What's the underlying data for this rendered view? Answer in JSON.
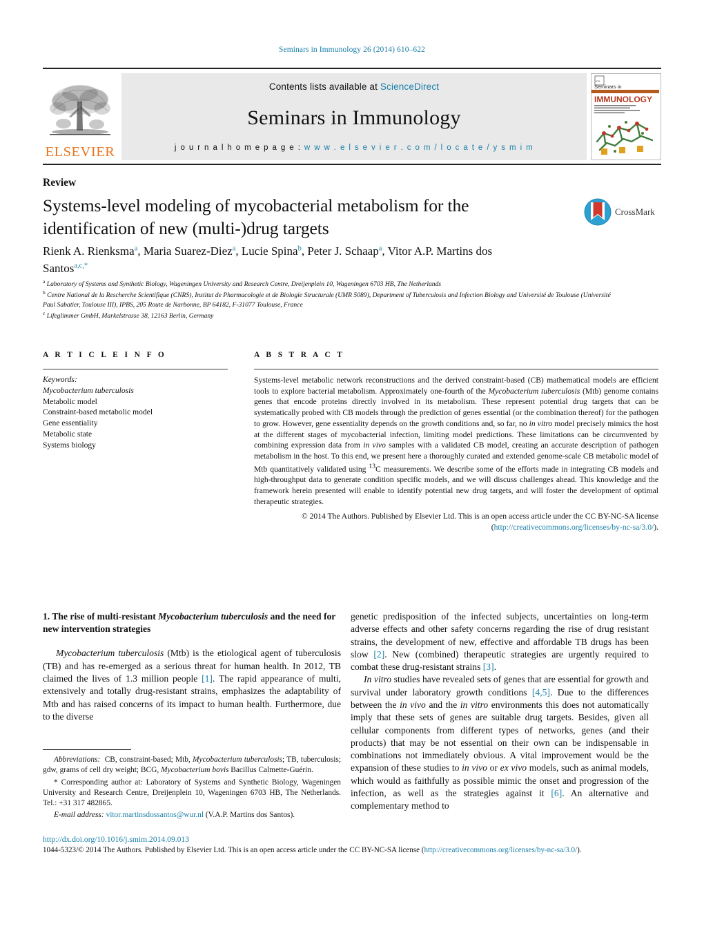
{
  "running_head": "Seminars in Immunology 26 (2014) 610–622",
  "masthead": {
    "contents_prefix": "Contents lists available at ",
    "contents_link": "ScienceDirect",
    "journal_title": "Seminars in Immunology",
    "homepage_prefix": "j o u r n a l   h o m e p a g e :   ",
    "homepage_url": "w w w . e l s e v i e r . c o m / l o c a t e / y s m i m",
    "publisher": "ELSEVIER",
    "cover": {
      "top_label": "Seminars in",
      "main_label": "IMMUNOLOGY"
    }
  },
  "article": {
    "kicker": "Review",
    "title": "Systems-level modeling of mycobacterial metabolism for the identification of new (multi-)drug targets",
    "authors_html": "Rienk A. Rienksma<sup>a</sup>, Maria Suarez-Diez<sup>a</sup>, Lucie Spina<sup>b</sup>, Peter J. Schaap<sup>a</sup>, Vitor A.P. Martins dos Santos<sup>a,c,</sup><sup>*</sup>",
    "affiliations": [
      "Laboratory of Systems and Synthetic Biology, Wageningen University and Research Centre, Dreijenplein 10, Wageningen 6703 HB, The Netherlands",
      "Centre National de la Rescherche Scientifique (CNRS), Institut de Pharmacologie et de Biologie Structurale (UMR 5089), Department of Tuberculosis and Infection Biology and Université de Toulouse (Université Paul Sabatier, Toulouse III), IPBS, 205 Route de Narbonne, BP 64182, F-31077 Toulouse, France",
      "Lifeglimmer GmbH, Markelstrasse 38, 12163 Berlin, Germany"
    ],
    "affiliation_marks": [
      "a",
      "b",
      "c"
    ],
    "crossmark_label": "CrossMark"
  },
  "info": {
    "heading": "A R T I C L E   I N F O",
    "keywords_label": "Keywords:",
    "keywords": [
      "Mycobacterium tuberculosis",
      "Metabolic model",
      "Constraint-based metabolic model",
      "Gene essentiality",
      "Metabolic state",
      "Systems biology"
    ]
  },
  "abstract": {
    "heading": "A B S T R A C T",
    "body_html": "Systems-level metabolic network reconstructions and the derived constraint-based (CB) mathematical models are efficient tools to explore bacterial metabolism. Approximately one-fourth of the <i>Mycobacterium tuberculosis</i> (Mtb) genome contains genes that encode proteins directly involved in its metabolism. These represent potential drug targets that can be systematically probed with CB models through the prediction of genes essential (or the combination thereof) for the pathogen to grow. However, gene essentiality depends on the growth conditions and, so far, no <i>in vitro</i> model precisely mimics the host at the different stages of mycobacterial infection, limiting model predictions. These limitations can be circumvented by combining expression data from <i>in vivo</i> samples with a validated CB model, creating an accurate description of pathogen metabolism in the host. To this end, we present here a thoroughly curated and extended genome-scale CB metabolic model of Mtb quantitatively validated using <sup>13</sup>C measurements. We describe some of the efforts made in integrating CB models and high-throughput data to generate condition specific models, and we will discuss challenges ahead. This knowledge and the framework herein presented will enable to identify potential new drug targets, and will foster the development of optimal therapeutic strategies.",
    "copyright": "© 2014 The Authors. Published by Elsevier Ltd. This is an open access article under the CC BY-NC-SA license (",
    "license_url": "http://creativecommons.org/licenses/by-nc-sa/3.0/",
    "copyright_tail": ")."
  },
  "section": {
    "number_title_html": "1.  The rise of multi-resistant <i>Mycobacterium tuberculosis</i> and the need for new intervention strategies",
    "paragraphs_left": [
      "<i>Mycobacterium tuberculosis</i> (Mtb) is the etiological agent of tuberculosis (TB) and has re-emerged as a serious threat for human health. In 2012, TB claimed the lives of 1.3 million people <span class=\"ref\">[1]</span>. The rapid appearance of multi, extensively and totally drug-resistant strains, emphasizes the adaptability of Mtb and has raised concerns of its impact to human health. Furthermore, due to the diverse"
    ],
    "paragraphs_right": [
      "genetic predisposition of the infected subjects, uncertainties on long-term adverse effects and other safety concerns regarding the rise of drug resistant strains, the development of new, effective and affordable TB drugs has been slow <span class=\"ref\">[2]</span>. New (combined) therapeutic strategies are urgently required to combat these drug-resistant strains <span class=\"ref\">[3]</span>.",
      "<i>In vitro</i> studies have revealed sets of genes that are essential for growth and survival under laboratory growth conditions <span class=\"ref\">[4,5]</span>. Due to the differences between the <i>in vivo</i> and the <i>in vitro</i> environments this does not automatically imply that these sets of genes are suitable drug targets. Besides, given all cellular components from different types of networks, genes (and their products) that may be not essential on their own can be indispensable in combinations not immediately obvious. A vital improvement would be the expansion of these studies to <i>in vivo</i> or <i>ex vivo</i> models, such as animal models, which would as faithfully as possible mimic the onset and progression of the infection, as well as the strategies against it <span class=\"ref\">[6]</span>. An alternative and complementary method to"
    ]
  },
  "footnotes": {
    "abbreviations_html": "<i>Abbreviations:</i>&nbsp; CB, constraint-based; Mtb, <i>Mycobacterium tuberculosis</i>; TB, tuberculosis; gdw, grams of cell dry weight; BCG, <i>Mycobacterium bovis</i> Bacillus Calmette-Guérin.",
    "corresponding_html": "* Corresponding author at: Laboratory of Systems and Synthetic Biology, Wageningen University and Research Centre, Dreijenplein 10, Wageningen 6703 HB, The Netherlands. Tel.: +31 317 482865.",
    "email_label": "E-mail address:",
    "email": "vitor.martinsdossantos@wur.nl",
    "email_suffix": "(V.A.P. Martins dos Santos)."
  },
  "footer": {
    "doi": "http://dx.doi.org/10.1016/j.smim.2014.09.013",
    "issn_prefix": "1044-5323/© 2014 The Authors. Published by Elsevier Ltd. This is an open access article under the CC BY-NC-SA license (",
    "issn_link": "http://creativecommons.org/licenses/by-nc-sa/3.0/",
    "issn_tail": ")."
  },
  "colors": {
    "accent_blue": "#1a7fa8",
    "elsevier_orange": "#E87722",
    "panel_gray": "#e9e9e9",
    "rule_dark": "#222222"
  }
}
